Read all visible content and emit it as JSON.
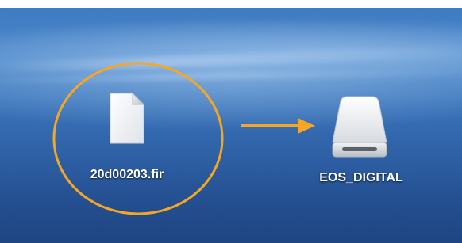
{
  "desktop": {
    "background_color": "#3a74ba",
    "file": {
      "name": "20d00203.fir",
      "icon": "document-icon"
    },
    "drive": {
      "name": "EOS_DIGITAL",
      "icon": "external-drive-icon"
    },
    "annotation": {
      "highlight_color": "#f5a623",
      "arrow_color": "#f5a623",
      "arrow_icon": "arrow-right-icon"
    }
  }
}
